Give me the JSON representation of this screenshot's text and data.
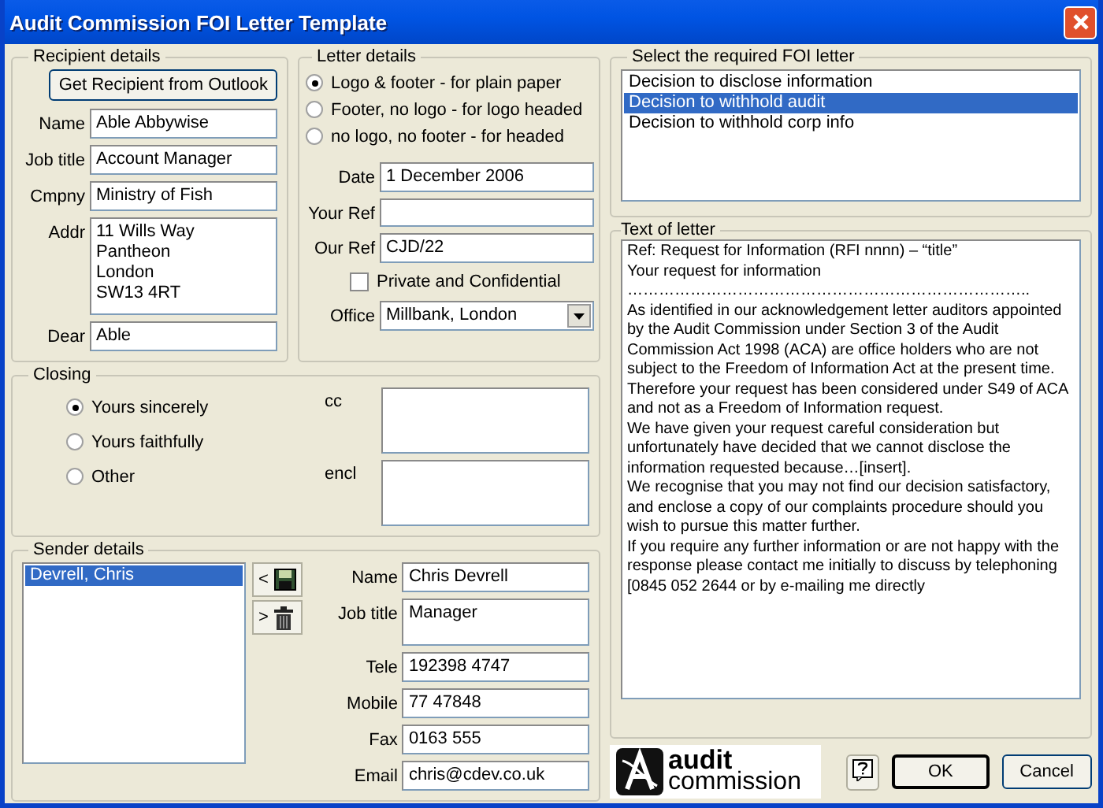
{
  "window": {
    "title": "Audit Commission FOI Letter Template"
  },
  "recipient": {
    "legend": "Recipient details",
    "outlook_button": "Get Recipient from Outlook",
    "fields": [
      {
        "label": "Name",
        "value": "Able Abbywise",
        "kind": "text"
      },
      {
        "label": "Job title",
        "value": "Account Manager",
        "kind": "text"
      },
      {
        "label": "Cmpny",
        "value": "Ministry of Fish",
        "kind": "text"
      },
      {
        "label": "Addr",
        "value": "11 Wills Way\nPantheon\nLondon\nSW13 4RT",
        "kind": "multiline"
      },
      {
        "label": "Dear",
        "value": "Able",
        "kind": "text"
      }
    ]
  },
  "letter": {
    "legend": "Letter details",
    "layout_options": [
      {
        "label": "Logo & footer - for plain paper",
        "selected": true
      },
      {
        "label": "Footer, no logo - for logo headed",
        "selected": false
      },
      {
        "label": "no logo, no footer - for headed",
        "selected": false
      }
    ],
    "fields": [
      {
        "label": "Date",
        "value": "1 December 2006"
      },
      {
        "label": "Your Ref"
      },
      {
        "label": "Our Ref",
        "value": "CJD/22"
      }
    ],
    "private_confidential": {
      "label": "Private and Confidential",
      "checked": false
    },
    "office": {
      "label": "Office",
      "value": "Millbank, London"
    }
  },
  "closing": {
    "legend": "Closing",
    "options": [
      {
        "label": "Yours sincerely",
        "selected": true
      },
      {
        "label": "Yours faithfully",
        "selected": false
      },
      {
        "label": "Other",
        "selected": false
      }
    ],
    "fields": [
      {
        "label": "cc"
      },
      {
        "label": "encl"
      }
    ]
  },
  "sender": {
    "legend": "Sender details",
    "list": [
      {
        "name": "Devrell, Chris",
        "selected": true
      }
    ],
    "move_buttons": [
      "<",
      ">"
    ],
    "fields": [
      {
        "label": "Name",
        "value": "Chris Devrell",
        "kind": "text"
      },
      {
        "label": "Job title",
        "value": "Manager",
        "kind": "tall"
      },
      {
        "label": "Tele",
        "value": "192398 4747",
        "kind": "text"
      },
      {
        "label": "Mobile",
        "value": "77 47848",
        "kind": "text"
      },
      {
        "label": "Fax",
        "value": "0163 555",
        "kind": "text"
      },
      {
        "label": "Email",
        "value": "chris@cdev.co.uk",
        "kind": "text"
      }
    ]
  },
  "letters": {
    "legend": "Select the required FOI letter",
    "items": [
      {
        "label": "Decision to disclose information",
        "selected": false
      },
      {
        "label": "Decision to withhold audit",
        "selected": true
      },
      {
        "label": "Decision to withhold corp info",
        "selected": false
      }
    ]
  },
  "letter_text": {
    "legend": "Text of letter",
    "paragraphs": [
      "Ref: Request for Information (RFI nnnn) – “title”",
      "Your request for information",
      "…………………………………………………………………..",
      "As identified in our acknowledgement letter auditors appointed by the Audit Commission under Section 3 of the Audit Commission Act 1998 (ACA) are office holders who are not subject to the Freedom of Information Act at the present time. Therefore your request has been considered under S49 of ACA and not as a Freedom of Information request.",
      "We have given your request careful consideration but unfortunately have decided that we cannot disclose the information requested because…[insert].",
      "We recognise that you may not find our decision satisfactory, and enclose a copy of our complaints procedure should you wish to pursue this matter further.",
      "If you require any further information or are not happy with the response please contact me initially to discuss by telephoning [0845 052 2644 or by e-mailing me directly"
    ]
  },
  "footer": {
    "logo": {
      "line_1": "audit",
      "line_2": "commission"
    },
    "buttons": [
      {
        "label": "OK",
        "kind": "default"
      },
      {
        "label": "Cancel",
        "kind": "normal"
      }
    ]
  }
}
